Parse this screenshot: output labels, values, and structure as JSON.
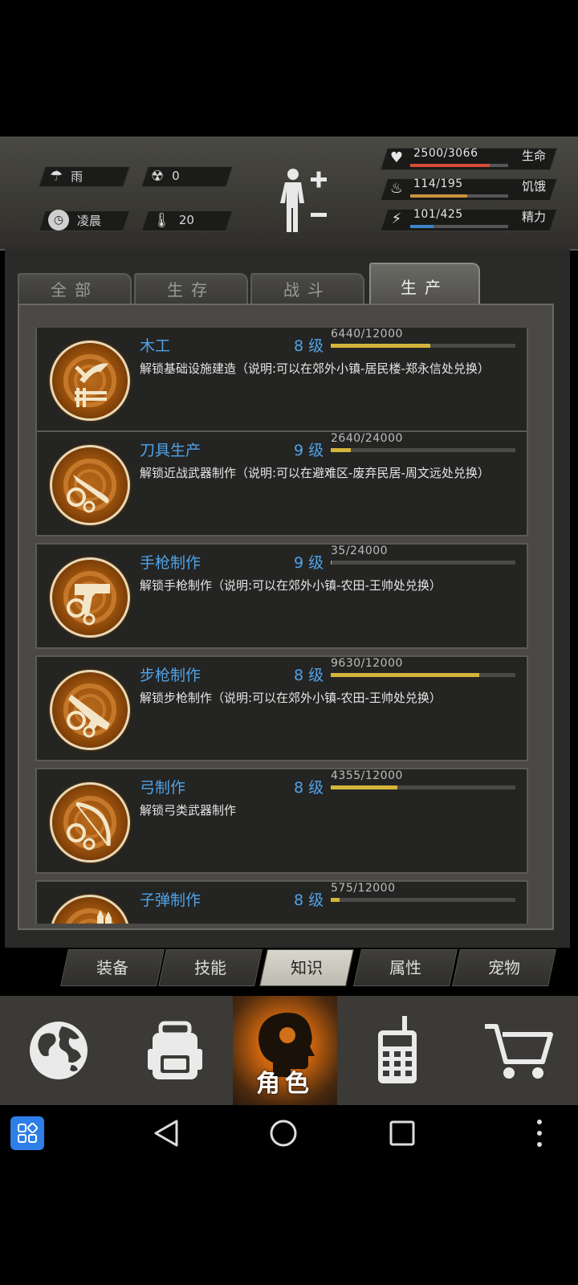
{
  "status": {
    "weather": "雨",
    "radiation": "0",
    "time_of_day": "凌晨",
    "temperature": "20",
    "stats": [
      {
        "icon": "heart-icon",
        "value": "2500/3066",
        "label": "生命",
        "fraction": 0.815,
        "color": "#d94b3b"
      },
      {
        "icon": "stomach-icon",
        "value": "114/195",
        "label": "饥饿",
        "fraction": 0.585,
        "color": "#c8923a"
      },
      {
        "icon": "energy-icon",
        "value": "101/425",
        "label": "精力",
        "fraction": 0.238,
        "color": "#3d84c9"
      }
    ]
  },
  "tabs": [
    {
      "label": "全部",
      "active": false
    },
    {
      "label": "生存",
      "active": false
    },
    {
      "label": "战斗",
      "active": false
    },
    {
      "label": "生产",
      "active": true
    }
  ],
  "skills": [
    {
      "name": "木工",
      "level": "8 级",
      "xp": "6440/12000",
      "progress": 0.537,
      "desc": "解锁基础设施建造（说明:可以在郊外小镇-居民楼-郑永信处兑换）",
      "icon": "carpentry-icon"
    },
    {
      "name": "刀具生产",
      "level": "9 级",
      "xp": "2640/24000",
      "progress": 0.11,
      "desc": "解锁近战武器制作（说明:可以在避难区-废弃民居-周文远处兑换）",
      "icon": "knife-making-icon"
    },
    {
      "name": "手枪制作",
      "level": "9 级",
      "xp": "35/24000",
      "progress": 0.0015,
      "desc": "解锁手枪制作（说明:可以在郊外小镇-农田-王帅处兑换）",
      "icon": "pistol-making-icon"
    },
    {
      "name": "步枪制作",
      "level": "8 级",
      "xp": "9630/12000",
      "progress": 0.8025,
      "desc": "解锁步枪制作（说明:可以在郊外小镇-农田-王帅处兑换）",
      "icon": "rifle-making-icon"
    },
    {
      "name": "弓制作",
      "level": "8 级",
      "xp": "4355/12000",
      "progress": 0.363,
      "desc": "解锁弓类武器制作",
      "icon": "bow-making-icon"
    },
    {
      "name": "子弹制作",
      "level": "8 级",
      "xp": "575/12000",
      "progress": 0.048,
      "desc": "",
      "icon": "bullet-making-icon"
    }
  ],
  "subtabs": [
    {
      "label": "装备",
      "active": false
    },
    {
      "label": "技能",
      "active": false
    },
    {
      "label": "知识",
      "active": true
    },
    {
      "label": "属性",
      "active": false
    },
    {
      "label": "宠物",
      "active": false
    }
  ],
  "bottom_nav": {
    "world": "globe-icon",
    "backpack": "backpack-icon",
    "character": "角色",
    "radio": "walkie-talkie-icon",
    "shop": "cart-icon"
  }
}
